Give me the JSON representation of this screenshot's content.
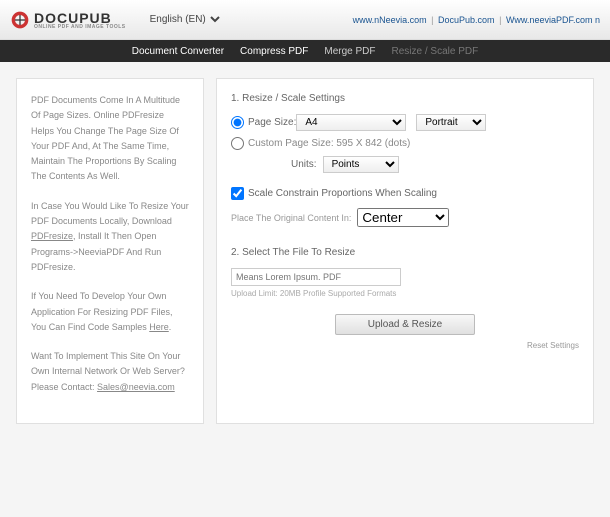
{
  "header": {
    "logo_text": "DOCUPUB",
    "logo_sub": "ONLINE PDF AND IMAGE TOOLS",
    "language": "English (EN)",
    "top_links": {
      "a": "www.nNeevia.com",
      "b": "DocuPub.com",
      "c": "Www.neeviaPDF.com",
      "d": "n"
    }
  },
  "nav": {
    "item1": "Document Converter",
    "item2": "Compress PDF",
    "item3": "Merge PDF",
    "item4": "Resize / Scale PDF"
  },
  "left": {
    "p1": "PDF Documents Come In A Multitude Of Page Sizes. Online PDFresize Helps You Change The Page Size Of Your PDF And, At The Same Time, Maintain The Proportions By Scaling The Contents As Well.",
    "p2a": "In Case You Would Like To Resize Your PDF Documents Locally, Download ",
    "p2link": "PDFresize",
    "p2b": ", Install It Then Open Programs->NeeviaPDF And Run PDFresize.",
    "p3a": "If You Need To Develop Your Own Application For Resizing PDF Files, You Can Find Code Samples ",
    "p3link": "Here",
    "p3b": ".",
    "p4a": "Want To Implement This Site On Your Own Internal Network Or Web Server?",
    "p4b": "Please Contact: ",
    "p4email": "Sales@neevia.com"
  },
  "right": {
    "section1": "1. Resize / Scale Settings",
    "page_size_label": "Page Size:",
    "page_size_value": "A4",
    "orientation": "Portrait",
    "custom_label": "Custom Page Size: 595 X 842 (dots)",
    "units_label": "Units:",
    "units_value": "Points",
    "constrain_label": "Scale Constrain Proportions When Scaling",
    "place_label": "Place The Original Content In:",
    "place_value": "Center",
    "section2": "2. Select The File To Resize",
    "file_placeholder": "Means Lorem Ipsum. PDF",
    "upload_note": "Upload Limit: 20MB Profile Supported Formats",
    "upload_btn": "Upload & Resize",
    "reset": "Reset Settings"
  }
}
